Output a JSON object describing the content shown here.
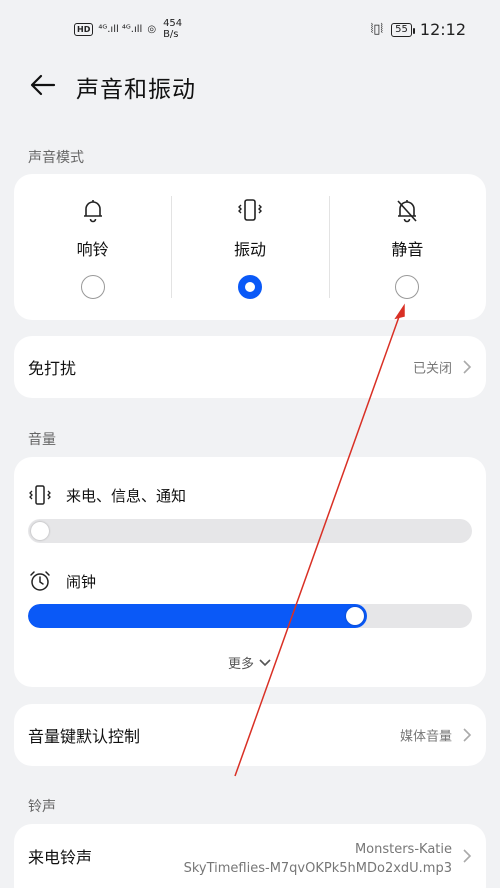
{
  "status_bar": {
    "hd": "HD",
    "net_speed_value": "454",
    "net_speed_unit": "B/s",
    "battery": "55",
    "time": "12:12"
  },
  "header": {
    "title": "声音和振动"
  },
  "sound_mode": {
    "section_label": "声音模式",
    "options": [
      {
        "label": "响铃",
        "icon": "bell-icon",
        "selected": false
      },
      {
        "label": "振动",
        "icon": "vibrate-icon",
        "selected": true
      },
      {
        "label": "静音",
        "icon": "bell-off-icon",
        "selected": false
      }
    ]
  },
  "dnd": {
    "label": "免打扰",
    "value": "已关闭"
  },
  "volume": {
    "section_label": "音量",
    "calls_label": "来电、信息、通知",
    "calls_level": 0.0,
    "alarm_label": "闹钟",
    "alarm_level": 0.75,
    "more_label": "更多"
  },
  "volume_key": {
    "label": "音量键默认控制",
    "value": "媒体音量"
  },
  "ringtone": {
    "section_label": "铃声",
    "label": "来电铃声",
    "value_line1": "Monsters-Katie",
    "value_line2": "SkyTimeflies-M7qvOKPk5hMDo2xdU.mp3"
  },
  "colors": {
    "accent": "#0a59f7",
    "background": "#f1f2f4",
    "annotation_arrow": "#d93025"
  }
}
